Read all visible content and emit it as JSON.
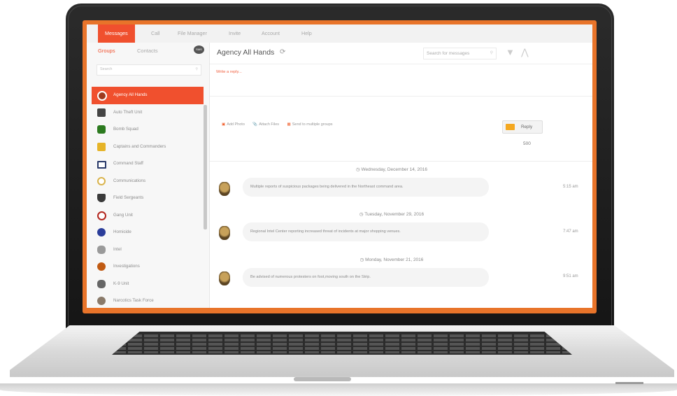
{
  "nav": {
    "tabs": [
      {
        "label": "Messages",
        "active": true
      },
      {
        "label": "Call",
        "active": false
      },
      {
        "label": "File Manager",
        "active": false
      },
      {
        "label": "Invite",
        "active": false
      },
      {
        "label": "Account",
        "active": false
      },
      {
        "label": "Help",
        "active": false
      }
    ]
  },
  "sidebar": {
    "tabs": [
      {
        "label": "Groups",
        "active": true
      },
      {
        "label": "Contacts",
        "active": false
      }
    ],
    "sms_label": "SMS",
    "search_placeholder": "Search",
    "groups": [
      {
        "label": "Agency All Hands",
        "active": true,
        "icon": "badge-icon",
        "color": "#9e3a1e"
      },
      {
        "label": "Auto Theft Unit",
        "active": false,
        "icon": "car-icon",
        "color": "#444444"
      },
      {
        "label": "Bomb Squad",
        "active": false,
        "icon": "bomb-icon",
        "color": "#2c7a1f"
      },
      {
        "label": "Captains and Commanders",
        "active": false,
        "icon": "star-icon",
        "color": "#e6b428"
      },
      {
        "label": "Command Staff",
        "active": false,
        "icon": "flag-icon",
        "color": "#2a3a6a"
      },
      {
        "label": "Communications",
        "active": false,
        "icon": "radio-icon",
        "color": "#d9b34b"
      },
      {
        "label": "Field Sergeants",
        "active": false,
        "icon": "chevron-icon",
        "color": "#3a3a3a"
      },
      {
        "label": "Gang Unit",
        "active": false,
        "icon": "no-gang-icon",
        "color": "#b3261e"
      },
      {
        "label": "Homicide",
        "active": false,
        "icon": "globe-icon",
        "color": "#2b3d9a"
      },
      {
        "label": "Intel",
        "active": false,
        "icon": "eagle-icon",
        "color": "#777777"
      },
      {
        "label": "Investigations",
        "active": false,
        "icon": "magnifier-icon",
        "color": "#c05a12"
      },
      {
        "label": "K-9 Unit",
        "active": false,
        "icon": "dog-icon",
        "color": "#666666"
      },
      {
        "label": "Narcotics Task Force",
        "active": false,
        "icon": "pill-icon",
        "color": "#8a7a6a"
      }
    ]
  },
  "main": {
    "title": "Agency All Hands",
    "search_placeholder": "Search for messages",
    "reply_placeholder": "Write a reply...",
    "actions": [
      {
        "label": "Add Photo",
        "icon": "camera-icon"
      },
      {
        "label": "Attach Files",
        "icon": "paperclip-icon"
      },
      {
        "label": "Send to multiple groups",
        "icon": "groups-icon"
      }
    ],
    "reply_button": "Reply",
    "char_count": "500",
    "messages": [
      {
        "date": "Wednesday, December 14, 2016",
        "text": "Multiple reports of suspicious packages being delivered in the Northeast command area.",
        "time": "5:15 am"
      },
      {
        "date": "Tuesday, November 29, 2016",
        "text": "Regional Intel Center reporting increased threat of incidents at major shopping venues.",
        "time": "7:47 am"
      },
      {
        "date": "Monday, November 21, 2016",
        "text": "Be advised of numerous protesters on foot,moving south on the Strip.",
        "time": "9:51 am"
      }
    ]
  },
  "colors": {
    "accent": "#f0502e",
    "frame": "#e8742a"
  }
}
